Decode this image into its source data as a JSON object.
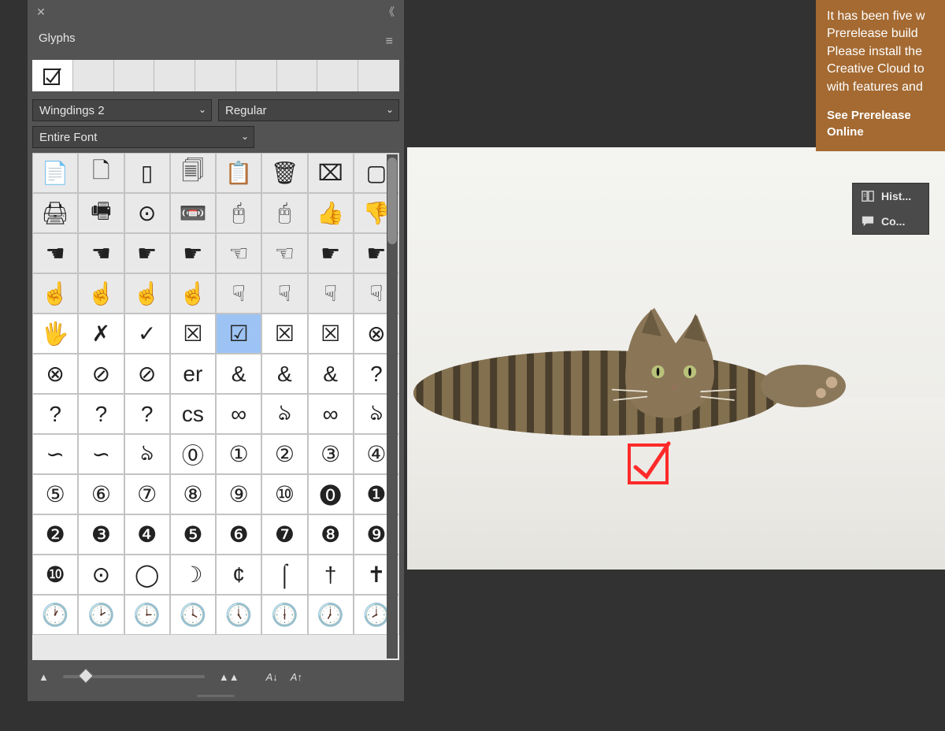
{
  "panel": {
    "title": "Glyphs",
    "font": "Wingdings 2",
    "style": "Regular",
    "subset": "Entire Font",
    "recent_glyph": "☑",
    "selected_glyph": "☑",
    "footer_sort_asc": "A↓",
    "footer_sort_desc": "A↑",
    "glyph_rows": [
      [
        "📄",
        "🗋",
        "▯",
        "🗐",
        "📋",
        "🗑",
        "⌧",
        "▢"
      ],
      [
        "🖨",
        "🖷",
        "⊙",
        "📼",
        "🖰",
        "🖰",
        "👍",
        "👎"
      ],
      [
        "☚",
        "☚",
        "☛",
        "☛",
        "☜",
        "☜",
        "☛",
        "☛"
      ],
      [
        "☝",
        "☝",
        "☝",
        "☝",
        "☟",
        "☟",
        "☟",
        "☟"
      ],
      [
        "🖐",
        "✗",
        "✓",
        "☒",
        "☑",
        "☒",
        "☒",
        "⊗"
      ],
      [
        "⊗",
        "⊘",
        "⊘",
        "er",
        "&",
        "&",
        "&",
        "?"
      ],
      [
        "?",
        "?",
        "?",
        "cs",
        "∞",
        "ঌ",
        "∞",
        "ঌ"
      ],
      [
        "∽",
        "∽",
        "ঌ",
        "⓪",
        "①",
        "②",
        "③",
        "④"
      ],
      [
        "⑤",
        "⑥",
        "⑦",
        "⑧",
        "⑨",
        "⑩",
        "⓿",
        "❶"
      ],
      [
        "❷",
        "❸",
        "❹",
        "❺",
        "❻",
        "❼",
        "❽",
        "❾"
      ],
      [
        "❿",
        "⊙",
        "◯",
        "☽",
        "¢",
        "⌠",
        "†",
        "✝"
      ],
      [
        "🕐",
        "🕑",
        "🕒",
        "🕓",
        "🕔",
        "🕕",
        "🕖",
        "🕗"
      ]
    ]
  },
  "notification": {
    "line1": "It has been five w",
    "line2": "Prerelease build",
    "line3": "Please install the",
    "line4": "Creative Cloud to",
    "line5": "with features and",
    "link1": "See Prerelease",
    "link2": "Online"
  },
  "right_panel": {
    "item1": "Hist...",
    "item2": "Co..."
  },
  "canvas": {
    "overlay_glyph": "checkbox-checkmark",
    "overlay_color": "#ff2e2e"
  }
}
